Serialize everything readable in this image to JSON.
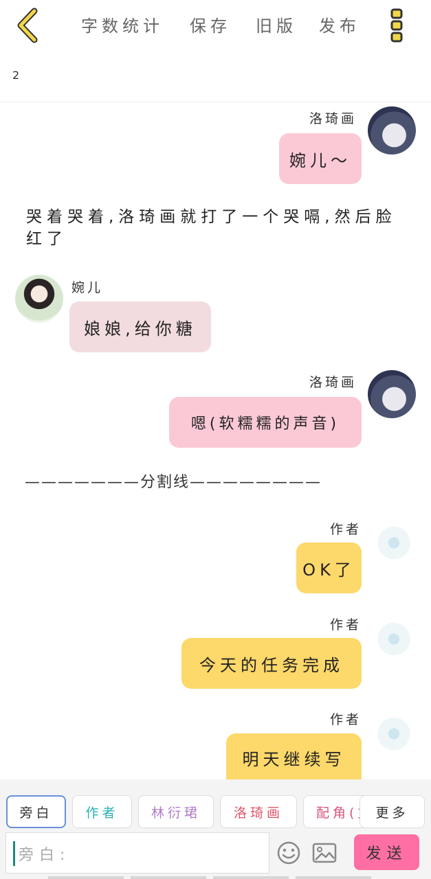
{
  "header": {
    "word_count": "字数统计",
    "save": "保存",
    "old_version": "旧版",
    "publish": "发布"
  },
  "count": "2",
  "messages": [
    {
      "name": "洛琦画",
      "text": "婉儿～"
    },
    {
      "narration": "哭着哭着,洛琦画就打了一个哭嗝,然后脸红了"
    },
    {
      "name": "婉儿",
      "text": "娘娘,给你糖"
    },
    {
      "name": "洛琦画",
      "text": "嗯(软糯糯的声音)"
    },
    {
      "separator": "———————分割线————————"
    },
    {
      "name": "作者",
      "text": "OK了"
    },
    {
      "name": "作者",
      "text": "今天的任务完成"
    },
    {
      "name": "作者",
      "text": "明天继续写"
    }
  ],
  "roles": [
    "旁白",
    "作者",
    "林衍珺",
    "洛琦画",
    "配角(文",
    "更多"
  ],
  "input": {
    "placeholder": "旁白:"
  },
  "send_label": "发送",
  "colors": {
    "pink_bubble": "#fbc9d6",
    "light_pink_bubble": "#f3dcdf",
    "yellow_bubble": "#fdd86a",
    "send_button": "#ff6fa3",
    "role_zuozhe": "#2ab0b0",
    "role_linyanjun": "#b07cc8",
    "role_luoqihua": "#e0566a",
    "role_peijue": "#d9547a"
  },
  "icons": [
    "back-icon",
    "more-menu-icon",
    "emoji-icon",
    "image-icon"
  ]
}
